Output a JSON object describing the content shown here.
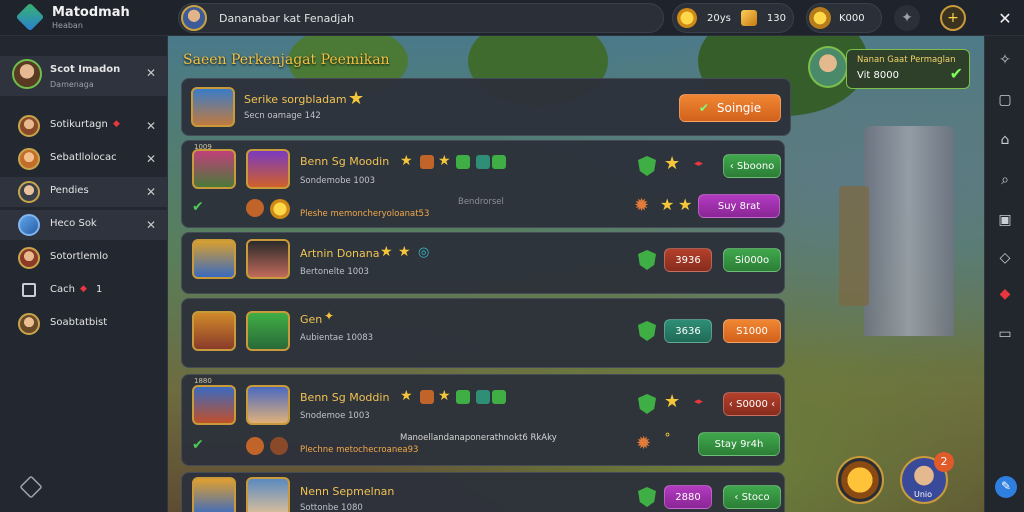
{
  "app": {
    "title": "Matodmah",
    "subtitle": "Heaban"
  },
  "search": {
    "value": "Dananabar kat Fenadjah"
  },
  "currencies": [
    {
      "icon": "coin-icon",
      "label": "20ys"
    },
    {
      "icon": "gem-icon",
      "label": "130"
    },
    {
      "icon": "medal-icon",
      "label": "K000"
    }
  ],
  "sidebar": {
    "items": [
      {
        "label": "Scot Imadon",
        "sub": "Damenaga",
        "closable": true
      },
      {
        "label": "Sotikurtagn",
        "badge": "gem",
        "closable": true
      },
      {
        "label": "Sebatllolocac",
        "closable": true
      },
      {
        "label": "Pendies",
        "closable": true
      },
      {
        "label": "Heco Sok",
        "closable": true
      },
      {
        "label": "Sotortlemlo",
        "closable": false
      },
      {
        "label": "Cach",
        "badge_count": "1",
        "closable": false
      },
      {
        "label": "Soabtatbist",
        "closable": false
      }
    ]
  },
  "panel": {
    "title": "Saeen Perkenjagat Peemikan"
  },
  "header_card": {
    "name": "Serike sorgbladam",
    "sub": "Secn oamage 142",
    "button": "Soingie"
  },
  "rows": [
    {
      "tiny": "1009",
      "name": "Benn Sg Moodin",
      "sub": "Sondemobe 1003",
      "note": "Pleshe memoncheryoloanat53",
      "note_faint": "Bendrorsel",
      "score": "‹ Sboono",
      "action": "Suy 8rat"
    },
    {
      "tiny": "",
      "name": "Artnin Donana",
      "sub": "Bertonelte 1003",
      "score": "3936",
      "action": "Si000o"
    },
    {
      "tiny": "",
      "name": "Gen",
      "sub": "Aubientae 10083",
      "score": "3636",
      "action": "S1000"
    },
    {
      "tiny": "1880",
      "name": "Benn Sg Moddin",
      "sub": "Snodemoe 1003",
      "note": "Plechne metochecroanea93",
      "note_faint": "Manoellandanaponerathnokt6 RkAky",
      "score": "‹ S0000 ‹",
      "action": "Stay 9r4h"
    },
    {
      "tiny": "",
      "name": "Nenn Sepmelnan",
      "sub": "Sottonbe 1080",
      "score": "2880",
      "action": "‹ Stoco"
    }
  ],
  "quest": {
    "title": "Nanan Gaat Permaglan",
    "value": "Vit 8000"
  },
  "fab": {
    "badge": "2",
    "label": "Unio"
  },
  "colors": {
    "accent_gold": "#f3c244",
    "green": "#3fa84d",
    "orange": "#f08733",
    "purple": "#b23ac0"
  }
}
